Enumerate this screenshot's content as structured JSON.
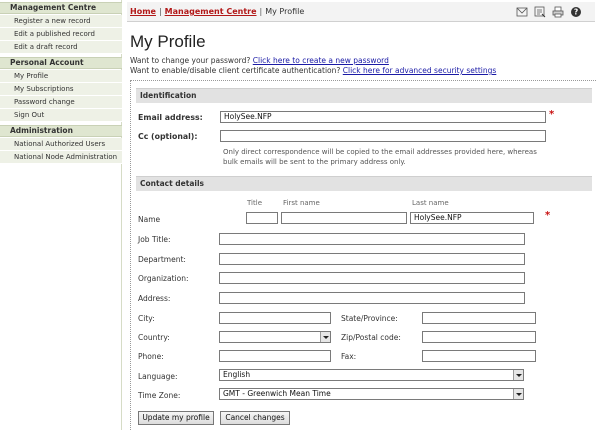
{
  "sidebar": {
    "sections": [
      {
        "title": "Management Centre",
        "items": [
          "Register a new record",
          "Edit a published record",
          "Edit a draft record"
        ]
      },
      {
        "title": "Personal Account",
        "items": [
          "My Profile",
          "My Subscriptions",
          "Password change",
          "Sign Out"
        ]
      },
      {
        "title": "Administration",
        "items": [
          "National Authorized Users",
          "National Node Administration"
        ]
      }
    ]
  },
  "breadcrumb": {
    "home": "Home",
    "sep": "|",
    "management": "Management Centre",
    "current": "My Profile"
  },
  "toolbar_icons": [
    "email-icon",
    "feedback-icon",
    "print-icon",
    "help-icon"
  ],
  "page": {
    "title": "My Profile",
    "password_prompt": "Want to change your password?",
    "password_link": "Click here to create a new password",
    "cert_prompt": "Want to enable/disable client certificate authentication?",
    "cert_link": "Click here for advanced security settings"
  },
  "identification": {
    "heading": "Identification",
    "email_label": "Email address:",
    "email_value": "HolySee.NFP",
    "cc_label": "Cc (optional):",
    "cc_value": "",
    "cc_note_1": "Only direct correspondence will be copied to the email addresses provided here, whereas",
    "cc_note_2": "bulk emails will be sent to the primary address only."
  },
  "contact": {
    "heading": "Contact details",
    "col_title": "Title",
    "col_first": "First name",
    "col_last": "Last name",
    "name_label": "Name",
    "name_title": "",
    "name_first": "",
    "name_last": "HolySee.NFP",
    "job_title_label": "Job Title:",
    "department_label": "Department:",
    "organization_label": "Organization:",
    "address_label": "Address:",
    "city_label": "City:",
    "state_label": "State/Province:",
    "country_label": "Country:",
    "zip_label": "Zip/Postal code:",
    "phone_label": "Phone:",
    "fax_label": "Fax:",
    "language_label": "Language:",
    "language_value": "English",
    "timezone_label": "Time Zone:",
    "timezone_value": "GMT - Greenwich Mean Time"
  },
  "buttons": {
    "update": "Update my profile",
    "cancel": "Cancel changes"
  },
  "colors": {
    "link": "#1a1aa6",
    "breadcrumb_link": "#b21818",
    "required": "#c81010",
    "sidebar_bg": "#eef1e6",
    "sidebar_head": "#dfe6d0"
  }
}
